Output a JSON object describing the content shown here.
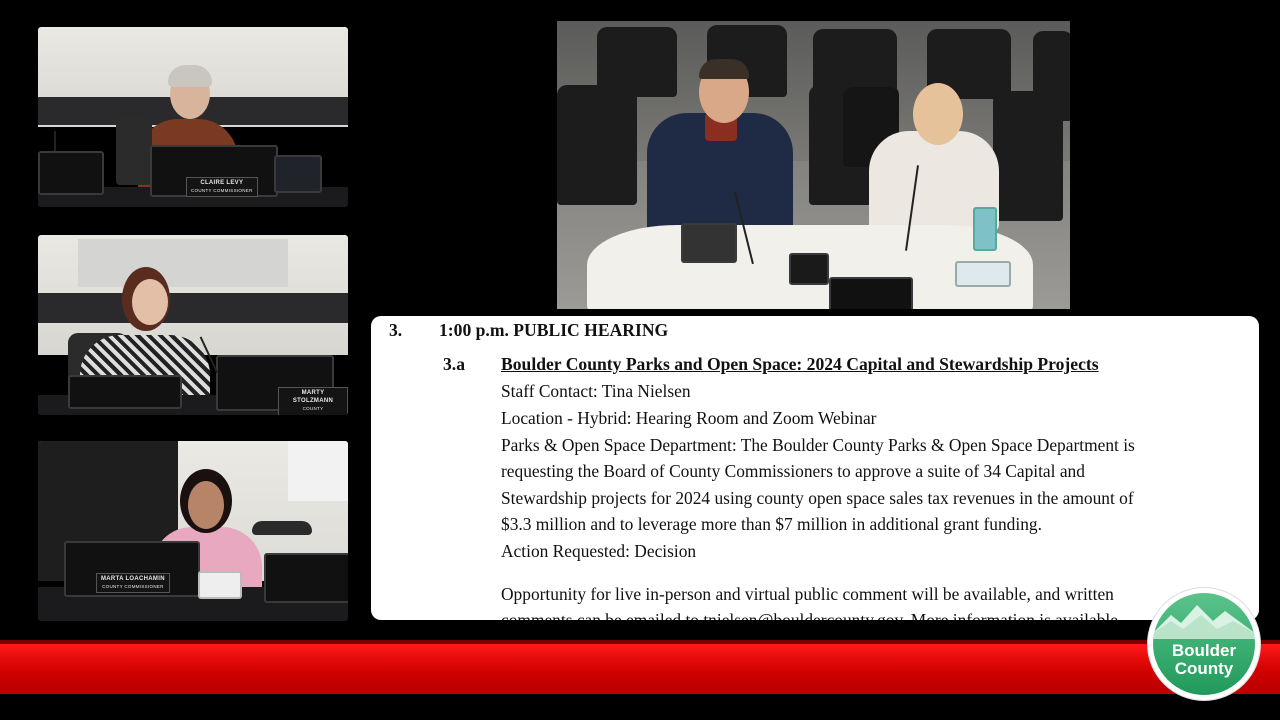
{
  "video_tiles": {
    "commissioner_1": {
      "name": "CLAIRE LEVY",
      "title": "COUNTY COMMISSIONER"
    },
    "commissioner_2": {
      "name": "MARTY STOLZMANN",
      "title": "COUNTY COMMISSIONER"
    },
    "commissioner_3": {
      "name": "MARTA LOACHAMIN",
      "title": "COUNTY COMMISSIONER"
    }
  },
  "document": {
    "item_number": "3.",
    "item_heading": "1:00 p.m. PUBLIC HEARING",
    "sub_number": "3.a",
    "sub_title": "Boulder County Parks and Open Space: 2024 Capital and Stewardship Projects",
    "lines": [
      "Staff Contact: Tina Nielsen",
      "Location - Hybrid: Hearing Room and Zoom Webinar",
      "Parks & Open Space Department: The Boulder County Parks & Open Space Department is",
      "requesting the Board of County Commissioners to approve a suite of 34 Capital and",
      "Stewardship projects for 2024 using county open space sales tax revenues in the amount of",
      "$3.3 million and to leverage more than $7 million in additional grant funding.",
      "Action Requested: Decision"
    ],
    "comment_line_1": "Opportunity for live in-person and virtual public comment will be available, and written",
    "comment_line_2": "comments can be emailed to tnielsen@bouldercounty.gov. More information is available"
  },
  "logo": {
    "line1": "Boulder",
    "line2": "County"
  },
  "colors": {
    "banner_red": "#e00000",
    "logo_green": "#2aa866"
  }
}
